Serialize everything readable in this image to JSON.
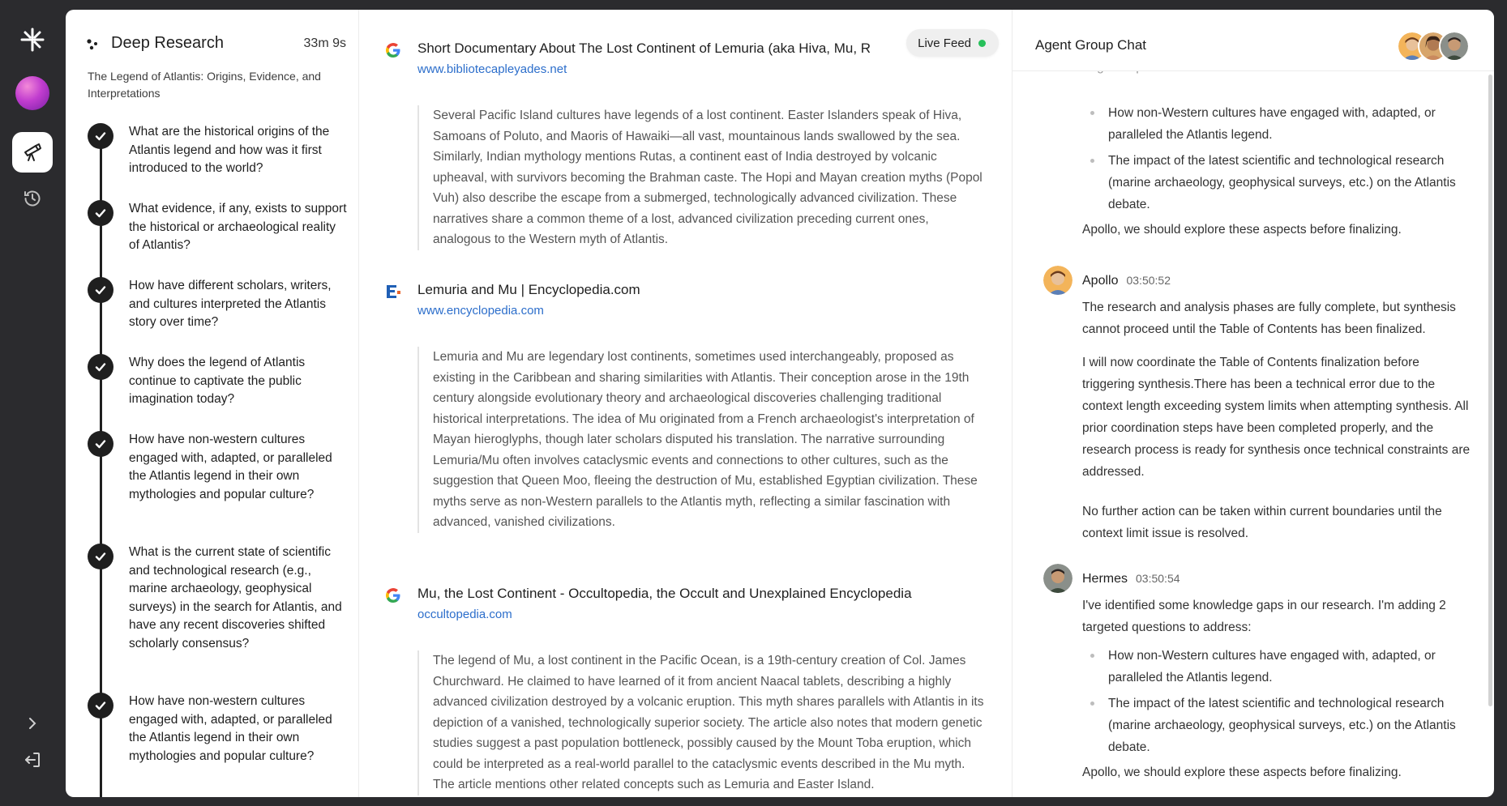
{
  "rail": {
    "items": [
      "logo-icon",
      "user-avatar",
      "research-icon",
      "history-icon",
      "expand-icon",
      "logout-icon"
    ]
  },
  "research": {
    "title": "Deep Research",
    "elapsed": "33m 9s",
    "subtitle": "The Legend of Atlantis: Origins, Evidence, and Interpretations",
    "steps": [
      "What are the historical origins of the Atlantis legend and how was it first introduced to the world?",
      "What evidence, if any, exists to support the historical or archaeological reality of Atlantis?",
      "How have different scholars, writers, and cultures interpreted the Atlantis story over time?",
      "Why does the legend of Atlantis continue to captivate the public imagination today?",
      "How have non-western cultures engaged with, adapted, or paralleled the Atlantis legend in their own mythologies and popular culture?",
      "What is the current state of scientific and technological research (e.g., marine archaeology, geophysical surveys) in the search for Atlantis, and have any recent discoveries shifted scholarly consensus?",
      "How have non-western cultures engaged with, adapted, or paralleled the Atlantis legend in their own mythologies and popular culture?"
    ]
  },
  "feed": {
    "live_label": "Live Feed",
    "sources": [
      {
        "icon": "google-icon",
        "title": "Short Documentary About The Lost Continent of Lemuria (aka Hiva, Mu, R",
        "url": "www.bibliotecapleyades.net",
        "excerpt": "Several Pacific Island cultures have legends of a lost continent. Easter Islanders speak of Hiva, Samoans of Poluto, and Maoris of Hawaiki—all vast, mountainous lands swallowed by the sea. Similarly, Indian mythology mentions Rutas, a continent east of India destroyed by volcanic upheaval, with survivors becoming the Brahman caste. The Hopi and Mayan creation myths (Popol Vuh) also describe the escape from a submerged, technologically advanced civilization. These narratives share a common theme of a lost, advanced civilization preceding current ones, analogous to the Western myth of Atlantis."
      },
      {
        "icon": "encyclopedia-icon",
        "title": "Lemuria and Mu | Encyclopedia.com",
        "url": "www.encyclopedia.com",
        "excerpt": "Lemuria and Mu are legendary lost continents, sometimes used interchangeably, proposed as existing in the Caribbean and sharing similarities with Atlantis. Their conception arose in the 19th century alongside evolutionary theory and archaeological discoveries challenging traditional historical interpretations. The idea of Mu originated from a French archaeologist's interpretation of Mayan hieroglyphs, though later scholars disputed his translation. The narrative surrounding Lemuria/Mu often involves cataclysmic events and connections to other cultures, such as the suggestion that Queen Moo, fleeing the destruction of Mu, established Egyptian civilization. These myths serve as non-Western parallels to the Atlantis myth, reflecting a similar fascination with advanced, vanished civilizations."
      },
      {
        "icon": "google-icon",
        "title": "Mu, the Lost Continent - Occultopedia, the Occult and Unexplained Encyclopedia",
        "url": "occultopedia.com",
        "excerpt": "The legend of Mu, a lost continent in the Pacific Ocean, is a 19th-century creation of Col. James Churchward. He claimed to have learned of it from ancient Naacal tablets, describing a highly advanced civilization destroyed by a volcanic eruption. This myth shares parallels with Atlantis in its depiction of a vanished, technologically superior society. The article also notes that modern genetic studies suggest a past population bottleneck, possibly caused by the Mount Toba eruption, which could be interpreted as a real-world parallel to the cataclysmic events described in the Mu myth. The article mentions other related concepts such as Lemuria and Easter Island."
      }
    ]
  },
  "chat": {
    "title": "Agent Group Chat",
    "top_fragment": "targeted questions to address:",
    "top_bullets": [
      "How non-Western cultures have engaged with, adapted, or paralleled the Atlantis legend.",
      "The impact of the latest scientific and technological research (marine archaeology, geophysical surveys, etc.) on the Atlantis debate."
    ],
    "top_closing": "Apollo, we should explore these aspects before finalizing.",
    "apollo": {
      "name": "Apollo",
      "time": "03:50:52",
      "p1": "The research and analysis phases are fully complete, but synthesis cannot proceed until the Table of Contents has been finalized.",
      "p2": "I will now coordinate the Table of Contents finalization before triggering synthesis.There has been a technical error due to the context length exceeding system limits when attempting synthesis. All prior coordination steps have been completed properly, and the research process is ready for synthesis once technical constraints are addressed.",
      "p3": "No further action can be taken within current boundaries until the context limit issue is resolved."
    },
    "hermes": {
      "name": "Hermes",
      "time": "03:50:54",
      "p1": "I've identified some knowledge gaps in our research. I'm adding 2 targeted questions to address:",
      "bullets": [
        "How non-Western cultures have engaged with, adapted, or paralleled the Atlantis legend.",
        "The impact of the latest scientific and technological research (marine archaeology, geophysical surveys, etc.) on the Atlantis debate."
      ],
      "closing": "Apollo, we should explore these aspects before finalizing."
    }
  },
  "colors": {
    "accent_link": "#2c6ecb",
    "live_dot": "#27c05a",
    "rail_bg": "#2b2b2e"
  }
}
